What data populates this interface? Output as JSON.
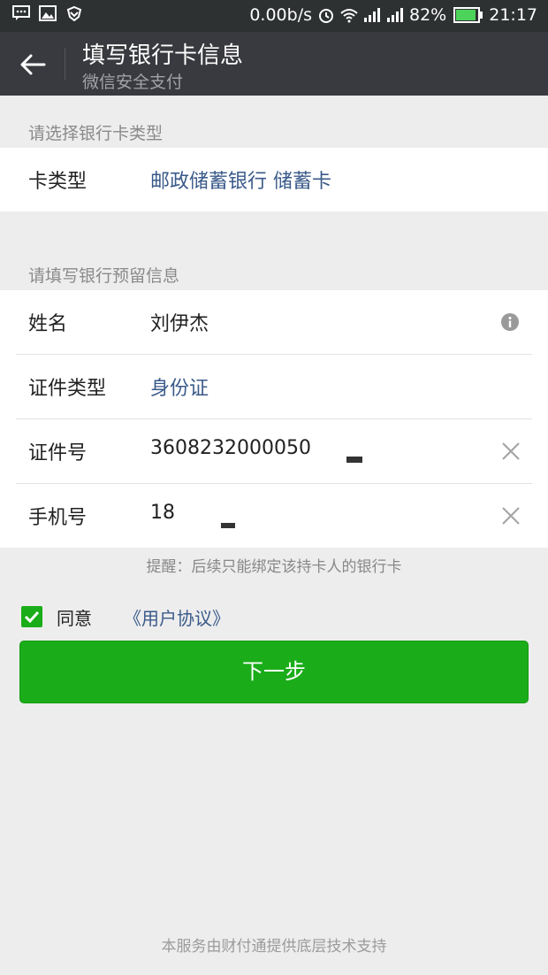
{
  "status_bar": {
    "network_speed": "0.00b/s",
    "battery": "82%",
    "battery_level": 0.82,
    "time": "21:17"
  },
  "nav": {
    "title": "填写银行卡信息",
    "subtitle": "微信安全支付"
  },
  "section_card_type": {
    "label": "请选择银行卡类型",
    "row": {
      "label": "卡类型",
      "value": "邮政储蓄银行 储蓄卡"
    }
  },
  "section_reserved": {
    "label": "请填写银行预留信息",
    "name": {
      "label": "姓名",
      "value": "刘伊杰"
    },
    "id_type": {
      "label": "证件类型",
      "value": "身份证"
    },
    "id_number": {
      "label": "证件号",
      "value": "3608232000050"
    },
    "phone": {
      "label": "手机号",
      "value": "18"
    }
  },
  "hint": "提醒：后续只能绑定该持卡人的银行卡",
  "agreement": {
    "checked": true,
    "label": "同意",
    "link": "《用户协议》"
  },
  "next_button": "下一步",
  "footer": "本服务由财付通提供底层技术支持"
}
